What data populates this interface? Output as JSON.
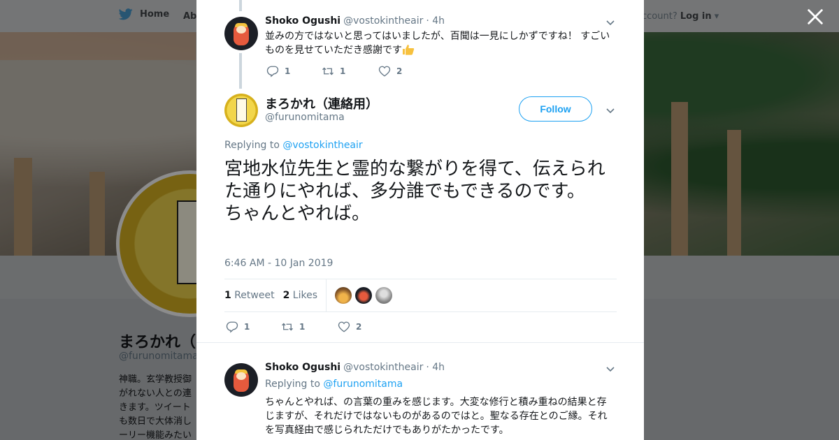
{
  "background_page": {
    "nav": {
      "home_label": "Home",
      "about_label": "Abo",
      "login_prefix": "ccount?",
      "login_label": "Log in"
    },
    "profile": {
      "name": "まろかれ（",
      "handle": "@furunomitama",
      "bio": "神職。玄学教授御\nがれない人との連\nきます。ツイート\nも数日で大体消し\nーリー機能みたい"
    }
  },
  "modal": {
    "close_icon": "close-icon",
    "tweets": [
      {
        "name": "Shoko Ogushi",
        "handle": "@vostokintheair",
        "time": "· 4h",
        "text": "並みの方ではないと思ってはいましたが、百聞は一見にしかずですね！ すごいものを見せていただき感謝です",
        "emoji": "thumbs-up",
        "replies": "1",
        "retweets": "1",
        "likes": "2"
      }
    ],
    "main_tweet": {
      "name": "まろかれ（連絡用）",
      "handle": "@furunomitama",
      "follow_label": "Follow",
      "replying_prefix": "Replying to",
      "replying_to": "@vostokintheair",
      "text": "宮地水位先生と霊的な繋がりを得て、伝えられた通りにやれば、多分誰でもできるのです。\nちゃんとやれば。",
      "timestamp": "6:46 AM - 10 Jan 2019",
      "retweet_count": "1",
      "retweet_label": "Retweet",
      "like_count": "2",
      "like_label": "Likes",
      "replies": "1",
      "retweets": "1",
      "likes": "2"
    },
    "reply_tweet": {
      "name": "Shoko Ogushi",
      "handle": "@vostokintheair",
      "time": "· 4h",
      "replying_prefix": "Replying to",
      "replying_to": "@furunomitama",
      "text": "ちゃんとやれば、の言葉の重みを感じます。大変な修行と積み重ねの結果と存じますが、それだけではないものがあるのではと。聖なる存在とのご縁。それを写真経由で感じられただけでもありがたかったです。"
    }
  },
  "colors": {
    "accent": "#1da1f2",
    "text": "#14171a",
    "muted": "#657786",
    "border": "#e6ecf0"
  }
}
